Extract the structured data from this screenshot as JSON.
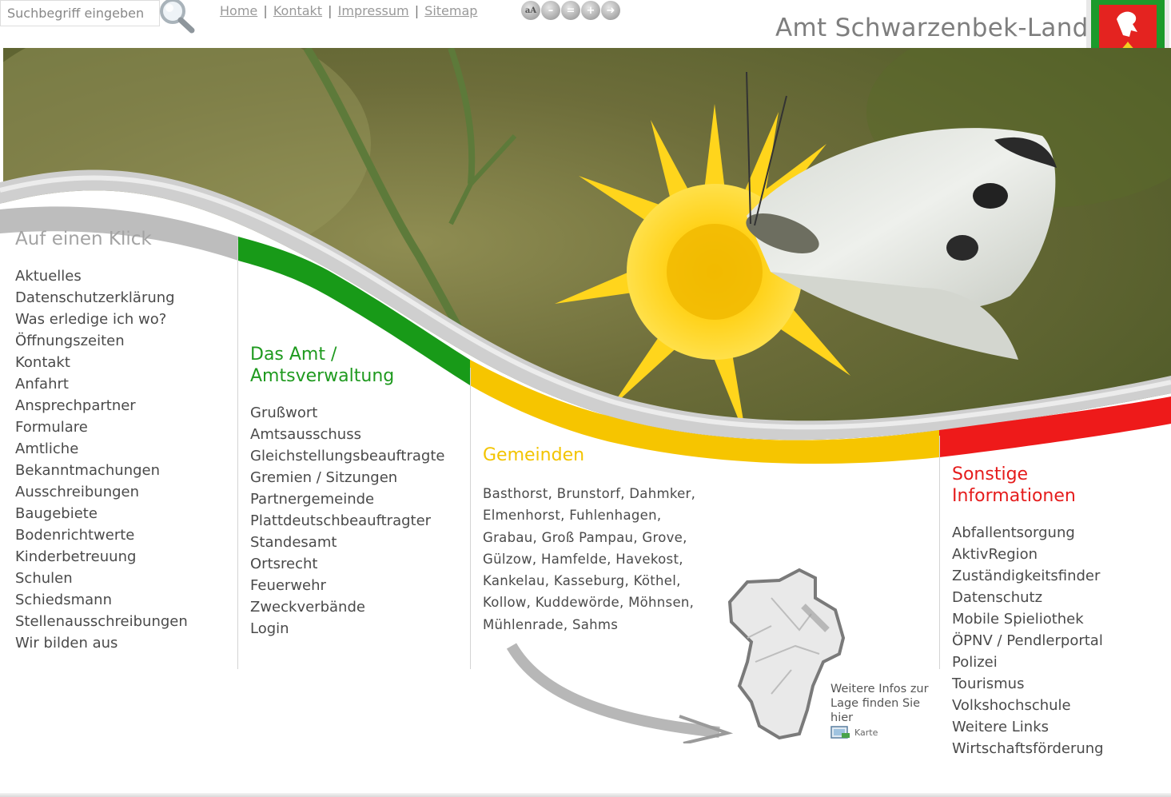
{
  "search": {
    "placeholder": "Suchbegriff eingeben"
  },
  "topnav": {
    "links": [
      "Home",
      "Kontakt",
      "Impressum",
      "Sitemap"
    ],
    "separator": "|"
  },
  "tools": {
    "text_label": "aA"
  },
  "brand": {
    "title": "Amt Schwarzenbek-Land"
  },
  "column1": {
    "title": "Auf einen Klick",
    "items": [
      "Aktuelles",
      "Datenschutzerklärung",
      "Was erledige ich wo?",
      "Öffnungszeiten",
      "Kontakt",
      "Anfahrt",
      "Ansprechpartner",
      "Formulare",
      "Amtliche",
      "Bekanntmachungen",
      "Ausschreibungen",
      "Baugebiete",
      "Bodenrichtwerte",
      "Kinderbetreuung",
      "Schulen",
      "Schiedsmann",
      "Stellenausschreibungen",
      "Wir bilden aus"
    ]
  },
  "column2": {
    "title_line1": "Das Amt /",
    "title_line2": "Amtsverwaltung",
    "items": [
      "Grußwort",
      "Amtsausschuss",
      "Gleichstellungsbeauftragte",
      "Gremien / Sitzungen",
      "Partnergemeinde",
      "Plattdeutschbeauftragter",
      "Standesamt",
      "Ortsrecht",
      "Feuerwehr",
      "Zweckverbände",
      "Login"
    ]
  },
  "column3": {
    "title": "Gemeinden",
    "items": [
      "Basthorst",
      "Brunstorf",
      "Dahmker",
      "Elmenhorst",
      "Fuhlenhagen",
      "Grabau",
      "Groß Pampau",
      "Grove",
      "Gülzow",
      "Hamfelde",
      "Havekost",
      "Kankelau",
      "Kasseburg",
      "Köthel",
      "Kollow",
      "Kuddewörde",
      "Möhnsen",
      "Mühlenrade",
      "Sahms"
    ],
    "map_info": "Weitere Infos zur Lage finden Sie hier",
    "map_link": "Karte"
  },
  "column4": {
    "title_line1": "Sonstige",
    "title_line2": "Informationen",
    "items": [
      "Abfallentsorgung",
      "AktivRegion",
      "Zuständigkeitsfinder",
      "Datenschutz",
      "Mobile Spieliothek",
      "ÖPNV / Pendlerportal",
      "Polizei",
      "Tourismus",
      "Volkshochschule",
      "Weitere Links",
      "Wirtschaftsförderung"
    ]
  },
  "colors": {
    "green": "#1f9a1f",
    "yellow": "#f3c400",
    "red": "#e51c1c",
    "grey": "#a3a3a3"
  }
}
